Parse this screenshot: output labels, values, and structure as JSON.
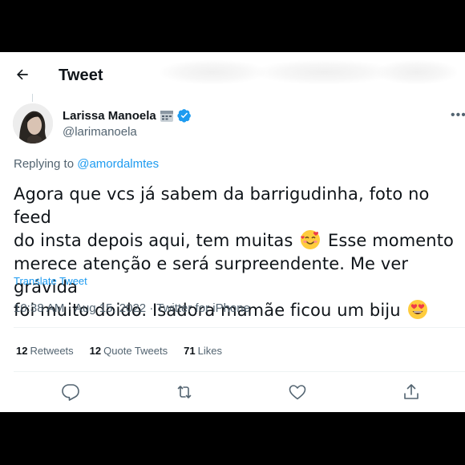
{
  "header": {
    "title": "Tweet",
    "back_icon": "arrow-left-icon"
  },
  "author": {
    "name": "Larissa Manoela",
    "name_emoji": "calendar-icon",
    "verified": true,
    "handle": "@larimanoela"
  },
  "replying": {
    "prefix": "Replying to ",
    "mention": "@amordalmtes"
  },
  "tweet": {
    "line1": "Agora que vcs já sabem da barrigudinha, foto no feed",
    "line2": "do insta depois aqui, tem muitas",
    "line3": "Esse momento",
    "line4": "merece atenção e será surpreendente. Me ver grávida",
    "line5": "foi muito doido. Isadora mamãe ficou um biju",
    "emoji1": "smiling-face-with-hearts",
    "emoji2": "heart-eyes"
  },
  "translate_label": "Translate Tweet",
  "meta": {
    "time": "10:38 AM",
    "sep": " · ",
    "date": "Aug 15, 2022",
    "source": "Twitter for iPhone"
  },
  "stats": {
    "retweets_count": "12",
    "retweets_label": "Retweets",
    "quotes_count": "12",
    "quotes_label": "Quote Tweets",
    "likes_count": "71",
    "likes_label": "Likes"
  },
  "actions": [
    "reply-icon",
    "retweet-icon",
    "like-icon",
    "share-icon"
  ],
  "colors": {
    "accent": "#1d9bf0",
    "secondary_text": "#536471",
    "primary_text": "#0f1419"
  }
}
